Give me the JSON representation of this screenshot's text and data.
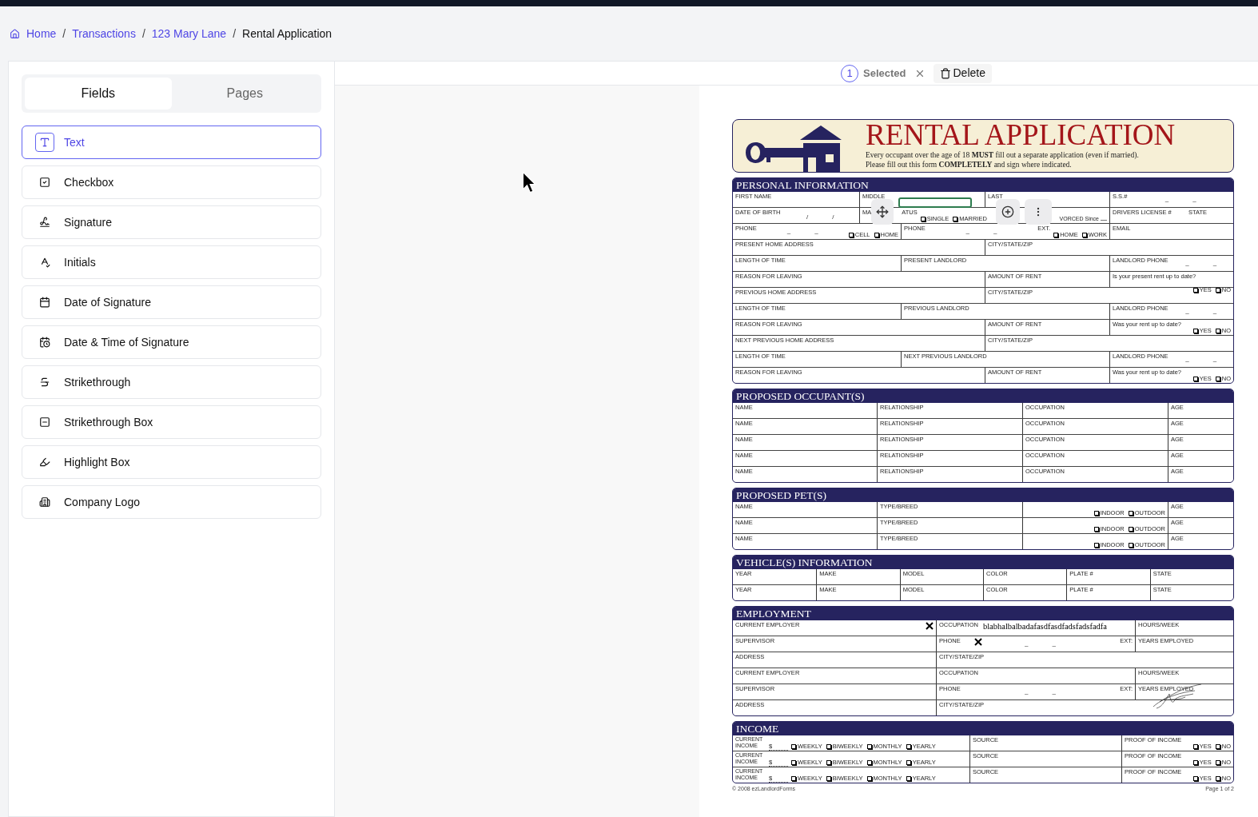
{
  "breadcrumb": [
    {
      "label": "Home",
      "current": false
    },
    {
      "separator": "/",
      "label": "Transactions",
      "current": false
    },
    {
      "separator": "/",
      "label": "123 Mary Lane",
      "current": false
    },
    {
      "separator": "/",
      "label": "Rental Application",
      "current": true
    }
  ],
  "sidebar": {
    "tabs": [
      {
        "label": "Fields",
        "selected": true
      },
      {
        "label": "Pages",
        "selected": false
      }
    ],
    "fields": [
      {
        "kind": "text",
        "label": "Text",
        "selected": true
      },
      {
        "kind": "checkbox",
        "label": "Checkbox",
        "selected": false
      },
      {
        "kind": "signature",
        "label": "Signature",
        "selected": false
      },
      {
        "kind": "initials",
        "label": "Initials",
        "selected": false
      },
      {
        "kind": "date",
        "label": "Date of Signature",
        "selected": false
      },
      {
        "kind": "datetime",
        "label": "Date & Time of Signature",
        "selected": false
      },
      {
        "kind": "strikethrough",
        "label": "Strikethrough",
        "selected": false
      },
      {
        "kind": "strikebox",
        "label": "Strikethrough Box",
        "selected": false
      },
      {
        "kind": "highlight",
        "label": "Highlight Box",
        "selected": false
      },
      {
        "kind": "logo",
        "label": "Company Logo",
        "selected": false
      }
    ]
  },
  "toolbar": {
    "count": "1",
    "status": "Selected",
    "delete": "Delete"
  },
  "document": {
    "title": "RENTAL APPLICATION",
    "notes": [
      "Every occupant over the age of 18 **MUST** fill out a separate application (even if married).",
      "Please fill out this form **COMPLETELY** and sign where indicated."
    ],
    "placed_field": {
      "selected": true
    },
    "sections": [
      {
        "title": "PERSONAL INFORMATION",
        "rows": [
          {
            "kind": "p1",
            "fields": [
              {
                "label": "FIRST NAME"
              },
              {
                "label": "MIDDLE"
              },
              {
                "label": "LAST"
              },
              {
                "label": "S.S.#",
                "marks": [
                  "–",
                  "–"
                ]
              }
            ]
          },
          {
            "kind": "p2",
            "fields": [
              {
                "label": "DATE OF BIRTH",
                "marks": [
                  "/",
                  "/"
                ]
              },
              {
                "label": "MA",
                "label_tail": "ATUS",
                "options": [
                  {
                    "label": "SINGLE",
                    "checked": false
                  },
                  {
                    "label": "MARRIED",
                    "checked": false
                  }
                ],
                "suffix": "VORCED Since"
              },
              {
                "label": "DRIVERS LICENSE #",
                "extra": "STATE"
              }
            ]
          },
          {
            "kind": "p3",
            "fields": [
              {
                "label": "PHONE",
                "marks": [
                  "–",
                  "–"
                ],
                "options": [
                  {
                    "label": "CELL",
                    "checked": false
                  },
                  {
                    "label": "HOME",
                    "checked": false
                  }
                ]
              },
              {
                "label": "PHONE",
                "marks": [
                  "–",
                  "–"
                ],
                "extra": "EXT.",
                "options": [
                  {
                    "label": "HOME",
                    "checked": false
                  },
                  {
                    "label": "WORK",
                    "checked": false
                  }
                ]
              },
              {
                "label": "EMAIL"
              }
            ]
          },
          {
            "kind": "addr",
            "fields": [
              {
                "label": "PRESENT HOME ADDRESS"
              },
              {
                "label": "CITY/STATE/ZIP"
              }
            ]
          },
          {
            "kind": "len",
            "fields": [
              {
                "label": "LENGTH OF TIME"
              },
              {
                "label": "PRESENT LANDLORD"
              },
              {
                "label": "LANDLORD PHONE",
                "marks": [
                  "–",
                  "–"
                ]
              }
            ]
          },
          {
            "kind": "reason",
            "fields": [
              {
                "label": "REASON FOR LEAVING"
              },
              {
                "label": "AMOUNT OF RENT"
              },
              {
                "label": "Is your present rent up to date?",
                "options": [
                  {
                    "label": "YES",
                    "checked": false
                  },
                  {
                    "label": "NO",
                    "checked": false
                  }
                ]
              }
            ]
          },
          {
            "kind": "addr",
            "fields": [
              {
                "label": "PREVIOUS HOME ADDRESS"
              },
              {
                "label": "CITY/STATE/ZIP"
              }
            ]
          },
          {
            "kind": "len",
            "fields": [
              {
                "label": "LENGTH OF TIME"
              },
              {
                "label": "PREVIOUS LANDLORD"
              },
              {
                "label": "LANDLORD PHONE",
                "marks": [
                  "–",
                  "–"
                ]
              }
            ]
          },
          {
            "kind": "reason",
            "fields": [
              {
                "label": "REASON FOR LEAVING"
              },
              {
                "label": "AMOUNT OF RENT"
              },
              {
                "label": "Was your rent up to date?",
                "options": [
                  {
                    "label": "YES",
                    "checked": false
                  },
                  {
                    "label": "NO",
                    "checked": false
                  }
                ]
              }
            ]
          },
          {
            "kind": "addr",
            "fields": [
              {
                "label": "NEXT PREVIOUS HOME ADDRESS"
              },
              {
                "label": "CITY/STATE/ZIP"
              }
            ]
          },
          {
            "kind": "len",
            "fields": [
              {
                "label": "LENGTH OF TIME"
              },
              {
                "label": "NEXT PREVIOUS LANDLORD"
              },
              {
                "label": "LANDLORD PHONE",
                "marks": [
                  "–",
                  "–"
                ]
              }
            ]
          },
          {
            "kind": "reason",
            "fields": [
              {
                "label": "REASON FOR LEAVING"
              },
              {
                "label": "AMOUNT OF RENT"
              },
              {
                "label": "Was your rent up to date?",
                "options": [
                  {
                    "label": "YES",
                    "checked": false
                  },
                  {
                    "label": "NO",
                    "checked": false
                  }
                ]
              }
            ]
          }
        ]
      },
      {
        "title": "PROPOSED OCCUPANT(S)",
        "rows": [
          {
            "kind": "occ",
            "fields": [
              {
                "label": "NAME"
              },
              {
                "label": "RELATIONSHIP"
              },
              {
                "label": "OCCUPATION"
              },
              {
                "label": "AGE"
              }
            ]
          },
          {
            "kind": "occ",
            "fields": [
              {
                "label": "NAME"
              },
              {
                "label": "RELATIONSHIP"
              },
              {
                "label": "OCCUPATION"
              },
              {
                "label": "AGE"
              }
            ]
          },
          {
            "kind": "occ",
            "fields": [
              {
                "label": "NAME"
              },
              {
                "label": "RELATIONSHIP"
              },
              {
                "label": "OCCUPATION"
              },
              {
                "label": "AGE"
              }
            ]
          },
          {
            "kind": "occ",
            "fields": [
              {
                "label": "NAME"
              },
              {
                "label": "RELATIONSHIP"
              },
              {
                "label": "OCCUPATION"
              },
              {
                "label": "AGE"
              }
            ]
          },
          {
            "kind": "occ",
            "fields": [
              {
                "label": "NAME"
              },
              {
                "label": "RELATIONSHIP"
              },
              {
                "label": "OCCUPATION"
              },
              {
                "label": "AGE"
              }
            ]
          }
        ]
      },
      {
        "title": "PROPOSED PET(S)",
        "rows": [
          {
            "kind": "occ",
            "fields": [
              {
                "label": "NAME"
              },
              {
                "label": "TYPE/BREED"
              },
              {
                "options": [
                  {
                    "label": "INDOOR",
                    "checked": false
                  },
                  {
                    "label": "OUTDOOR",
                    "checked": false
                  }
                ]
              },
              {
                "label": "AGE"
              }
            ]
          },
          {
            "kind": "occ",
            "fields": [
              {
                "label": "NAME"
              },
              {
                "label": "TYPE/BREED"
              },
              {
                "options": [
                  {
                    "label": "INDOOR",
                    "checked": false
                  },
                  {
                    "label": "OUTDOOR",
                    "checked": false
                  }
                ]
              },
              {
                "label": "AGE"
              }
            ]
          },
          {
            "kind": "occ",
            "fields": [
              {
                "label": "NAME"
              },
              {
                "label": "TYPE/BREED"
              },
              {
                "options": [
                  {
                    "label": "INDOOR",
                    "checked": false
                  },
                  {
                    "label": "OUTDOOR",
                    "checked": false
                  }
                ]
              },
              {
                "label": "AGE"
              }
            ]
          }
        ]
      },
      {
        "title": "VEHICLE(S) INFORMATION",
        "rows": [
          {
            "kind": "veh",
            "fields": [
              {
                "label": "YEAR"
              },
              {
                "label": "MAKE"
              },
              {
                "label": "MODEL"
              },
              {
                "label": "COLOR"
              },
              {
                "label": "PLATE #"
              },
              {
                "label": "STATE"
              }
            ]
          },
          {
            "kind": "veh",
            "fields": [
              {
                "label": "YEAR"
              },
              {
                "label": "MAKE"
              },
              {
                "label": "MODEL"
              },
              {
                "label": "COLOR"
              },
              {
                "label": "PLATE #"
              },
              {
                "label": "STATE"
              }
            ]
          }
        ]
      },
      {
        "title": "EMPLOYMENT",
        "rows": [
          {
            "kind": "emp",
            "fields": [
              {
                "label": "CURRENT EMPLOYER",
                "x_mark": true
              },
              {
                "label": "OCCUPATION",
                "value": "blabhalbalbadafasdfasdfadsfadsfadfa"
              },
              {
                "label": "HOURS/WEEK"
              }
            ]
          },
          {
            "kind": "emp",
            "fields": [
              {
                "label": "SUPERVISOR"
              },
              {
                "label": "PHONE",
                "x_mark": true,
                "marks": [
                  "–",
                  "–"
                ],
                "extra": "EXT:"
              },
              {
                "label": "YEARS EMPLOYED"
              }
            ]
          },
          {
            "kind": "emp_addr",
            "fields": [
              {
                "label": "ADDRESS"
              },
              {
                "label": "CITY/STATE/ZIP"
              }
            ]
          },
          {
            "kind": "emp",
            "fields": [
              {
                "label": "CURRENT EMPLOYER"
              },
              {
                "label": "OCCUPATION"
              },
              {
                "label": "HOURS/WEEK"
              }
            ]
          },
          {
            "kind": "emp",
            "fields": [
              {
                "label": "SUPERVISOR"
              },
              {
                "label": "PHONE",
                "marks": [
                  "–",
                  "–"
                ],
                "extra": "EXT:"
              },
              {
                "label": "YEARS EMPLOYED",
                "signature": true
              }
            ]
          },
          {
            "kind": "emp_addr",
            "fields": [
              {
                "label": "ADDRESS"
              },
              {
                "label": "CITY/STATE/ZIP"
              }
            ]
          }
        ]
      },
      {
        "title": "INCOME",
        "rows": [
          {
            "kind": "inc",
            "fields": [
              {
                "label": "CURRENT INCOME",
                "prefix": "$",
                "options": [
                  {
                    "label": "WEEKLY",
                    "checked": false
                  },
                  {
                    "label": "BIWEEKLY",
                    "checked": false
                  },
                  {
                    "label": "MONTHLY",
                    "checked": false
                  },
                  {
                    "label": "YEARLY",
                    "checked": false
                  }
                ]
              },
              {
                "label": "SOURCE"
              },
              {
                "label": "PROOF OF INCOME",
                "options": [
                  {
                    "label": "YES",
                    "checked": false
                  },
                  {
                    "label": "NO",
                    "checked": false
                  }
                ]
              }
            ]
          },
          {
            "kind": "inc",
            "fields": [
              {
                "label": "CURRENT INCOME",
                "prefix": "$",
                "options": [
                  {
                    "label": "WEEKLY",
                    "checked": false
                  },
                  {
                    "label": "BIWEEKLY",
                    "checked": false
                  },
                  {
                    "label": "MONTHLY",
                    "checked": false
                  },
                  {
                    "label": "YEARLY",
                    "checked": false
                  }
                ]
              },
              {
                "label": "SOURCE"
              },
              {
                "label": "PROOF OF INCOME",
                "options": [
                  {
                    "label": "YES",
                    "checked": false
                  },
                  {
                    "label": "NO",
                    "checked": false
                  }
                ]
              }
            ]
          },
          {
            "kind": "inc",
            "fields": [
              {
                "label": "CURRENT INCOME",
                "prefix": "$",
                "options": [
                  {
                    "label": "WEEKLY",
                    "checked": false
                  },
                  {
                    "label": "BIWEEKLY",
                    "checked": false
                  },
                  {
                    "label": "MONTHLY",
                    "checked": false
                  },
                  {
                    "label": "YEARLY",
                    "checked": false
                  }
                ]
              },
              {
                "label": "SOURCE"
              },
              {
                "label": "PROOF OF INCOME",
                "options": [
                  {
                    "label": "YES",
                    "checked": false
                  },
                  {
                    "label": "NO",
                    "checked": false
                  }
                ]
              }
            ]
          }
        ]
      }
    ],
    "footer": {
      "copyright": "© 2008 ezLandlordForms",
      "page": "Page 1 of 2"
    }
  }
}
